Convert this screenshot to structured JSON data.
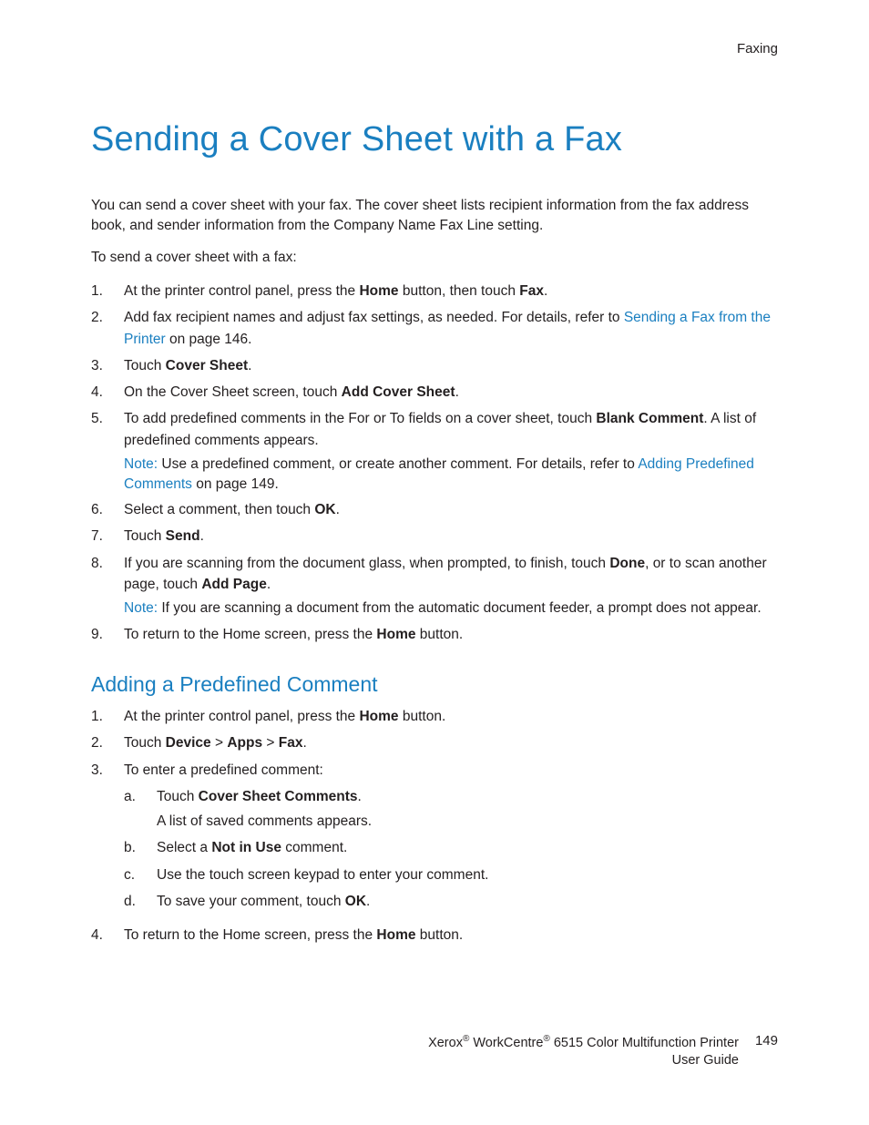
{
  "headerSection": "Faxing",
  "title": "Sending a Cover Sheet with a Fax",
  "intro": "You can send a cover sheet with your fax. The cover sheet lists recipient information from the fax address book, and sender information from the Company Name Fax Line setting.",
  "lead": "To send a cover sheet with a fax:",
  "s1_a": "At the printer control panel, press the ",
  "s1_b": "Home",
  "s1_c": " button, then touch ",
  "s1_d": "Fax",
  "s1_e": ".",
  "s2_a": "Add fax recipient names and adjust fax settings, as needed. For details, refer to ",
  "s2_link": "Sending a Fax from the Printer",
  "s2_b": " on page 146.",
  "s3_a": "Touch ",
  "s3_b": "Cover Sheet",
  "s3_c": ".",
  "s4_a": "On the Cover Sheet screen, touch ",
  "s4_b": "Add Cover Sheet",
  "s4_c": ".",
  "s5_a": "To add predefined comments in the For or To fields on a cover sheet, touch ",
  "s5_b": "Blank Comment",
  "s5_c": ". A list of predefined comments appears.",
  "s5_noteLabel": "Note:",
  "s5_note_a": " Use a predefined comment, or create another comment. For details, refer to ",
  "s5_note_link": "Adding Predefined Comments",
  "s5_note_b": " on page 149.",
  "s6_a": "Select a comment, then touch ",
  "s6_b": "OK",
  "s6_c": ".",
  "s7_a": "Touch ",
  "s7_b": "Send",
  "s7_c": ".",
  "s8_a": "If you are scanning from the document glass, when prompted, to finish, touch ",
  "s8_b": "Done",
  "s8_c": ", or to scan another page, touch ",
  "s8_d": "Add Page",
  "s8_e": ".",
  "s8_noteLabel": "Note:",
  "s8_note": " If you are scanning a document from the automatic document feeder, a prompt does not appear.",
  "s9_a": "To return to the Home screen, press the ",
  "s9_b": "Home",
  "s9_c": " button.",
  "h2": "Adding a Predefined Comment",
  "p1_a": "At the printer control panel, press the ",
  "p1_b": "Home",
  "p1_c": " button.",
  "p2_a": "Touch ",
  "p2_b": "Device",
  "p2_c": " > ",
  "p2_d": "Apps",
  "p2_e": " > ",
  "p2_f": "Fax",
  "p2_g": ".",
  "p3": "To enter a predefined comment:",
  "p3a_a": "Touch ",
  "p3a_b": "Cover Sheet Comments",
  "p3a_c": ".",
  "p3a_sub": "A list of saved comments appears.",
  "p3b_a": "Select a ",
  "p3b_b": "Not in Use",
  "p3b_c": " comment.",
  "p3c": "Use the touch screen keypad to enter your comment.",
  "p3d_a": "To save your comment, touch ",
  "p3d_b": "OK",
  "p3d_c": ".",
  "p4_a": "To return to the Home screen, press the ",
  "p4_b": "Home",
  "p4_c": " button.",
  "footer_a": "Xerox",
  "footer_b": " WorkCentre",
  "footer_c": " 6515 Color Multifunction Printer",
  "footer_d": "User Guide",
  "pageNum": "149",
  "reg": "®"
}
